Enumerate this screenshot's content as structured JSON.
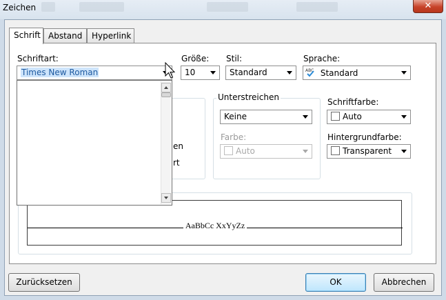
{
  "window": {
    "title": "Zeichen",
    "close_symbol": "✕"
  },
  "tabs": [
    {
      "label": "Schrift",
      "active": true
    },
    {
      "label": "Abstand",
      "active": false
    },
    {
      "label": "Hyperlink",
      "active": false
    }
  ],
  "font": {
    "label": "Schriftart:",
    "value": "Times New Roman"
  },
  "size": {
    "label": "Größe:",
    "value": "10"
  },
  "style": {
    "label": "Stil:",
    "value": "Standard"
  },
  "language": {
    "label": "Sprache:",
    "value": "Standard"
  },
  "underline": {
    "group_label": "Unterstreichen",
    "value": "Keine",
    "color_label": "Farbe:",
    "color_value": "Auto"
  },
  "font_color": {
    "label": "Schriftfarbe:",
    "value": "Auto"
  },
  "background_color": {
    "label": "Hintergrundfarbe:",
    "value": "Transparent"
  },
  "partial_options": {
    "fragment1": "en",
    "fragment2": "rt"
  },
  "preview": {
    "sample": "AaBbCc XxYyZz"
  },
  "buttons": {
    "reset": "Zurücksetzen",
    "ok": "OK",
    "cancel": "Abbrechen"
  },
  "colors": {
    "title_bar": "#dbe5f0",
    "close_button": "#c7432a",
    "selection": "#cde4fb",
    "default_button": "#bee6fd"
  }
}
